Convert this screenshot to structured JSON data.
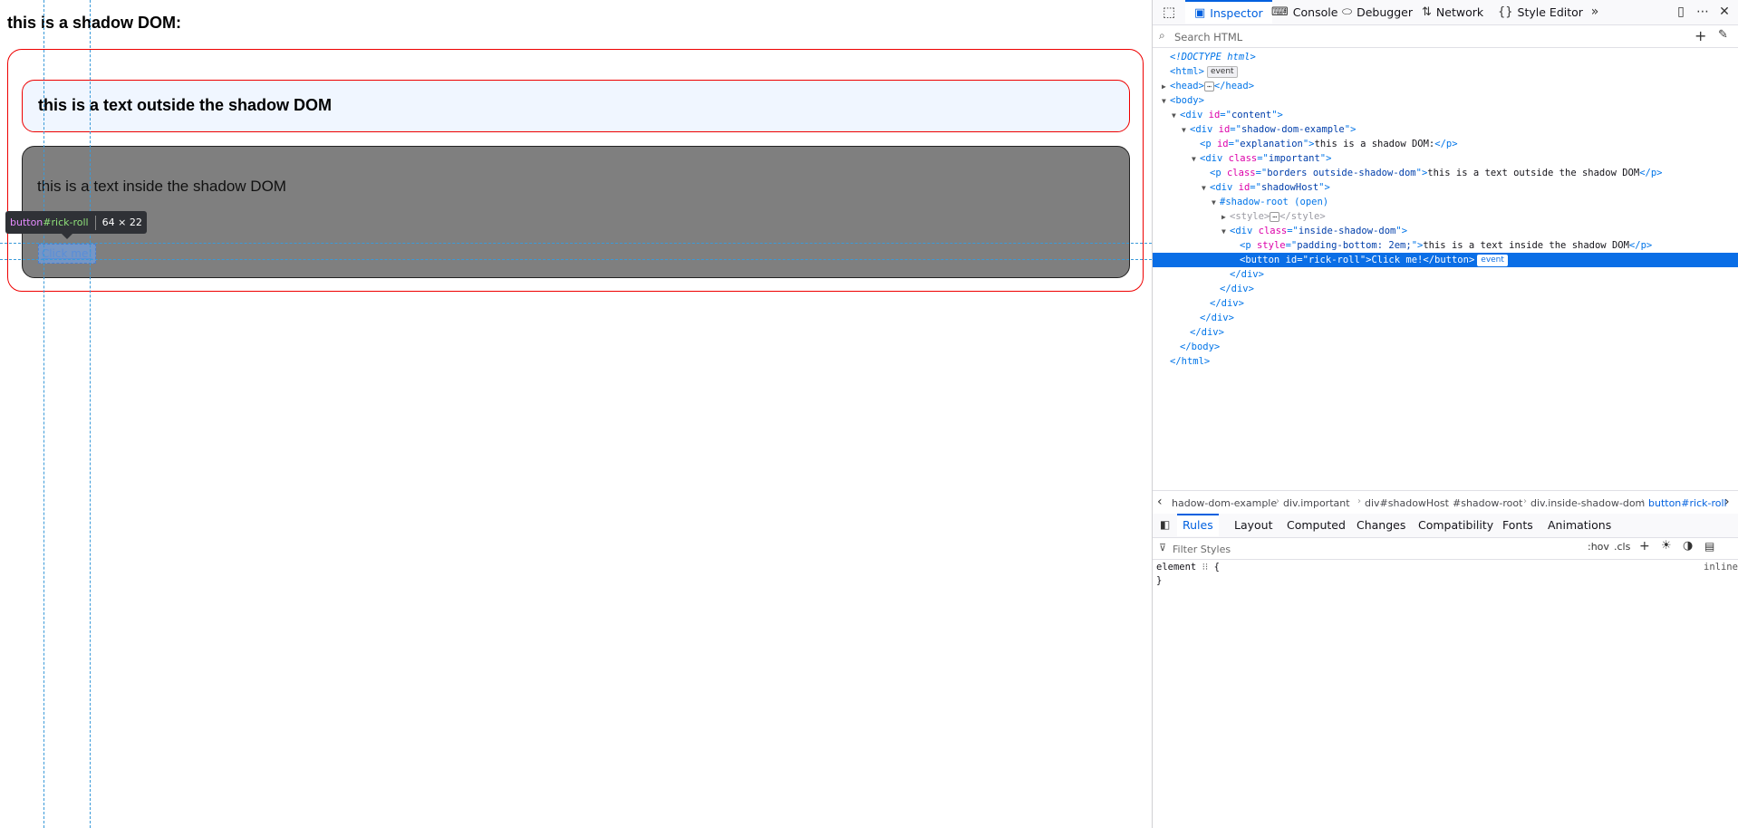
{
  "page": {
    "heading": "this is a shadow DOM:",
    "outside_text": "this is a text outside the shadow DOM",
    "inside_text": "this is a text inside the shadow DOM",
    "button_label": "Click me!",
    "tooltip": {
      "tag": "button",
      "id": "#rick-roll",
      "dims": "64 × 22"
    }
  },
  "devtools": {
    "tabs": [
      {
        "label": "Inspector",
        "icon": "inspector-icon"
      },
      {
        "label": "Console",
        "icon": "console-icon"
      },
      {
        "label": "Debugger",
        "icon": "debugger-icon"
      },
      {
        "label": "Network",
        "icon": "network-icon"
      },
      {
        "label": "Style Editor",
        "icon": "style-editor-icon"
      }
    ],
    "search_placeholder": "Search HTML",
    "markup": [
      {
        "indent": 0,
        "twisty": "",
        "kind": "doctype",
        "text": "<!DOCTYPE html>"
      },
      {
        "indent": 0,
        "twisty": "",
        "kind": "open",
        "tag": "html",
        "attrs": [],
        "badge": "event"
      },
      {
        "indent": 0,
        "twisty": "▶",
        "kind": "collapsed",
        "tag": "head"
      },
      {
        "indent": 0,
        "twisty": "▼",
        "kind": "open",
        "tag": "body",
        "attrs": []
      },
      {
        "indent": 1,
        "twisty": "▼",
        "kind": "open",
        "tag": "div",
        "attrs": [
          [
            "id",
            "content"
          ]
        ]
      },
      {
        "indent": 2,
        "twisty": "▼",
        "kind": "open",
        "tag": "div",
        "attrs": [
          [
            "id",
            "shadow-dom-example"
          ]
        ]
      },
      {
        "indent": 3,
        "twisty": "",
        "kind": "inline",
        "tag": "p",
        "attrs": [
          [
            "id",
            "explanation"
          ]
        ],
        "text": "this is a shadow DOM:"
      },
      {
        "indent": 3,
        "twisty": "▼",
        "kind": "open",
        "tag": "div",
        "attrs": [
          [
            "class",
            "important"
          ]
        ]
      },
      {
        "indent": 4,
        "twisty": "",
        "kind": "inline",
        "tag": "p",
        "attrs": [
          [
            "class",
            "borders outside-shadow-dom"
          ]
        ],
        "text": "this is a text outside the shadow DOM"
      },
      {
        "indent": 4,
        "twisty": "▼",
        "kind": "open",
        "tag": "div",
        "attrs": [
          [
            "id",
            "shadowHost"
          ]
        ]
      },
      {
        "indent": 5,
        "twisty": "▼",
        "kind": "shadow",
        "text": "#shadow-root (open)"
      },
      {
        "indent": 6,
        "twisty": "▶",
        "kind": "collapsed-dim",
        "tag": "style"
      },
      {
        "indent": 6,
        "twisty": "▼",
        "kind": "open",
        "tag": "div",
        "attrs": [
          [
            "class",
            "inside-shadow-dom"
          ]
        ]
      },
      {
        "indent": 7,
        "twisty": "",
        "kind": "inline",
        "tag": "p",
        "attrs": [
          [
            "style",
            "padding-bottom: 2em;"
          ]
        ],
        "text": "this is a text inside the shadow DOM"
      },
      {
        "indent": 7,
        "twisty": "",
        "kind": "inline",
        "tag": "button",
        "attrs": [
          [
            "id",
            "rick-roll"
          ]
        ],
        "text": "Click me!",
        "badge": "event",
        "selected": true
      },
      {
        "indent": 6,
        "twisty": "",
        "kind": "close",
        "tag": "div"
      },
      {
        "indent": 5,
        "twisty": "",
        "kind": "close",
        "tag": "div"
      },
      {
        "indent": 4,
        "twisty": "",
        "kind": "close",
        "tag": "div"
      },
      {
        "indent": 3,
        "twisty": "",
        "kind": "close",
        "tag": "div"
      },
      {
        "indent": 2,
        "twisty": "",
        "kind": "close",
        "tag": "div"
      },
      {
        "indent": 1,
        "twisty": "",
        "kind": "close",
        "tag": "body"
      },
      {
        "indent": 0,
        "twisty": "",
        "kind": "close",
        "tag": "html"
      }
    ],
    "breadcrumbs": [
      "hadow-dom-example",
      "div.important",
      "div#shadowHost",
      "#shadow-root",
      "div.inside-shadow-dom",
      "button#rick-roll"
    ],
    "rule_tabs": [
      "Rules",
      "Layout",
      "Computed",
      "Changes",
      "Compatibility",
      "Fonts",
      "Animations"
    ],
    "filter_placeholder": "Filter Styles",
    "filter_buttons": {
      "hov": ":hov",
      "cls": ".cls"
    },
    "rule": {
      "selector": "element",
      "open": "{",
      "close": "}",
      "source": "inline"
    }
  },
  "colors": {
    "selected_row": "#0a6ee6",
    "accent": "#0060df",
    "border_red": "#ee0000",
    "shadow_bg": "#7f7f7f"
  }
}
